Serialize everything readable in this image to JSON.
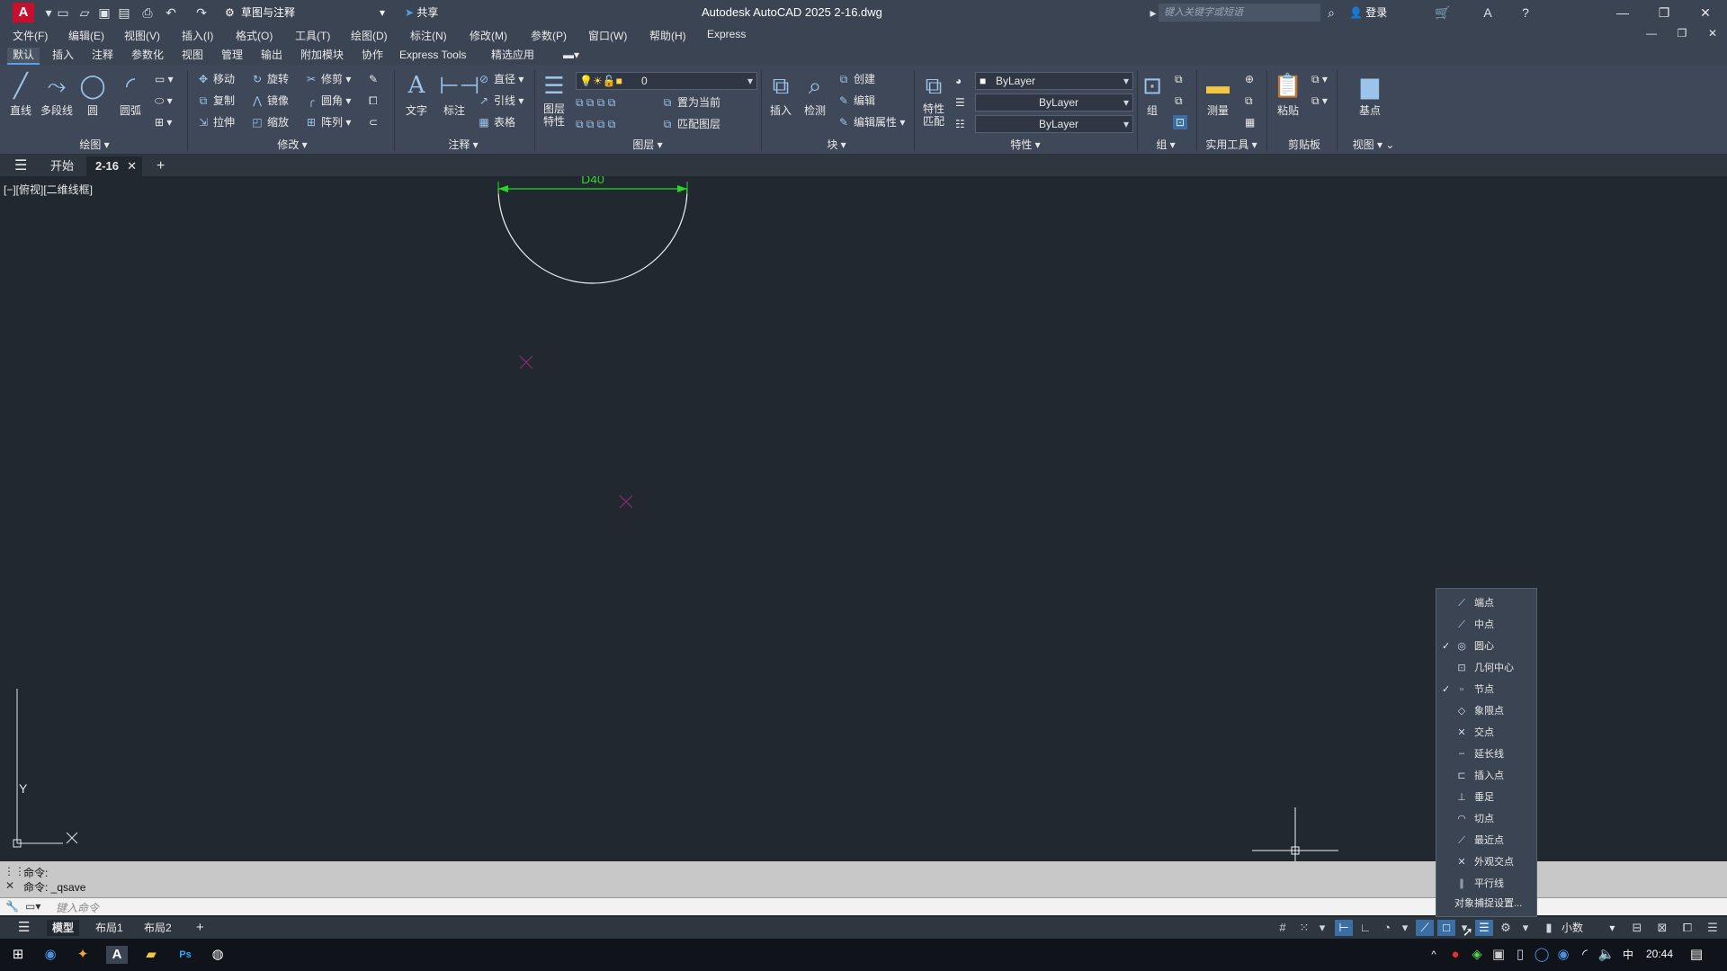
{
  "title_bar": {
    "logo": "A",
    "workspace": "草图与注释",
    "share": "共享",
    "title": "Autodesk AutoCAD 2025    2-16.dwg",
    "search_placeholder": "键入关键字或短语",
    "login": "登录"
  },
  "menu": [
    "文件(F)",
    "编辑(E)",
    "视图(V)",
    "插入(I)",
    "格式(O)",
    "工具(T)",
    "绘图(D)",
    "标注(N)",
    "修改(M)",
    "参数(P)",
    "窗口(W)",
    "帮助(H)",
    "Express"
  ],
  "ribbon_tabs": [
    "默认",
    "插入",
    "注释",
    "参数化",
    "视图",
    "管理",
    "输出",
    "附加模块",
    "协作",
    "Express Tools",
    "精选应用"
  ],
  "ribbon": {
    "draw": {
      "line": "直线",
      "polyline": "多段线",
      "circle": "圆",
      "arc": "圆弧",
      "footer": "绘图"
    },
    "modify": {
      "move": "移动",
      "rotate": "旋转",
      "trim": "修剪",
      "copy": "复制",
      "mirror": "镜像",
      "fillet": "圆角",
      "stretch": "拉伸",
      "scale": "缩放",
      "array": "阵列",
      "footer": "修改"
    },
    "annotation": {
      "text": "文字",
      "dimension": "标注",
      "diameter": "直径",
      "leader": "引线",
      "table": "表格",
      "footer": "注释"
    },
    "layers": {
      "layer_props": "图层\n特性",
      "layer_value": "0",
      "set_current": "置为当前",
      "match_layer": "匹配图层",
      "footer": "图层"
    },
    "block": {
      "insert": "插入",
      "detect": "检测",
      "create": "创建",
      "edit": "编辑",
      "edit_attr": "编辑属性",
      "footer": "块"
    },
    "properties": {
      "match": "特性\n匹配",
      "color": "ByLayer",
      "linetype": "ByLayer",
      "lineweight": "ByLayer",
      "footer": "特性"
    },
    "groups": {
      "group": "组",
      "footer": "组"
    },
    "utilities": {
      "measure": "测量",
      "footer": "实用工具"
    },
    "clipboard": {
      "paste": "粘贴",
      "footer": "剪贴板"
    },
    "view": {
      "base": "基点",
      "footer": "视图"
    }
  },
  "file_tabs": {
    "start": "开始",
    "current": "2-16"
  },
  "viewport_label": "[−][俯视][二维线框]",
  "dimension_text": "D40",
  "command": {
    "line1": "命令:",
    "line2": "命令:  _qsave",
    "prompt": "键入命令"
  },
  "layout_tabs": [
    "模型",
    "布局1",
    "布局2"
  ],
  "status": {
    "units": "小数"
  },
  "osnap_menu": {
    "items": [
      {
        "label": "端点",
        "checked": false,
        "icon": "endpoint-icon",
        "glyph": "⟋"
      },
      {
        "label": "中点",
        "checked": false,
        "icon": "midpoint-icon",
        "glyph": "⟋"
      },
      {
        "label": "圆心",
        "checked": true,
        "icon": "center-icon",
        "glyph": "◎"
      },
      {
        "label": "几何中心",
        "checked": false,
        "icon": "geometric-center-icon",
        "glyph": "⊡"
      },
      {
        "label": "节点",
        "checked": true,
        "icon": "node-icon",
        "glyph": "▫"
      },
      {
        "label": "象限点",
        "checked": false,
        "icon": "quadrant-icon",
        "glyph": "◇"
      },
      {
        "label": "交点",
        "checked": false,
        "icon": "intersection-icon",
        "glyph": "✕"
      },
      {
        "label": "延长线",
        "checked": false,
        "icon": "extension-icon",
        "glyph": "┄"
      },
      {
        "label": "插入点",
        "checked": false,
        "icon": "insertion-icon",
        "glyph": "⊏"
      },
      {
        "label": "垂足",
        "checked": false,
        "icon": "perpendicular-icon",
        "glyph": "⊥"
      },
      {
        "label": "切点",
        "checked": false,
        "icon": "tangent-icon",
        "glyph": "◠"
      },
      {
        "label": "最近点",
        "checked": false,
        "icon": "nearest-icon",
        "glyph": "⟋"
      },
      {
        "label": "外观交点",
        "checked": false,
        "icon": "apparent-intersection-icon",
        "glyph": "✕"
      },
      {
        "label": "平行线",
        "checked": false,
        "icon": "parallel-icon",
        "glyph": "∥"
      }
    ],
    "settings": "对象捕捉设置..."
  },
  "taskbar": {
    "ime": "中",
    "time": "20:44"
  },
  "colors": {
    "canvas": "#212830",
    "dimension": "#27d627",
    "circle": "#f2f2f2",
    "marker": "#8e2a6e",
    "ribbon": "#3f4858"
  }
}
